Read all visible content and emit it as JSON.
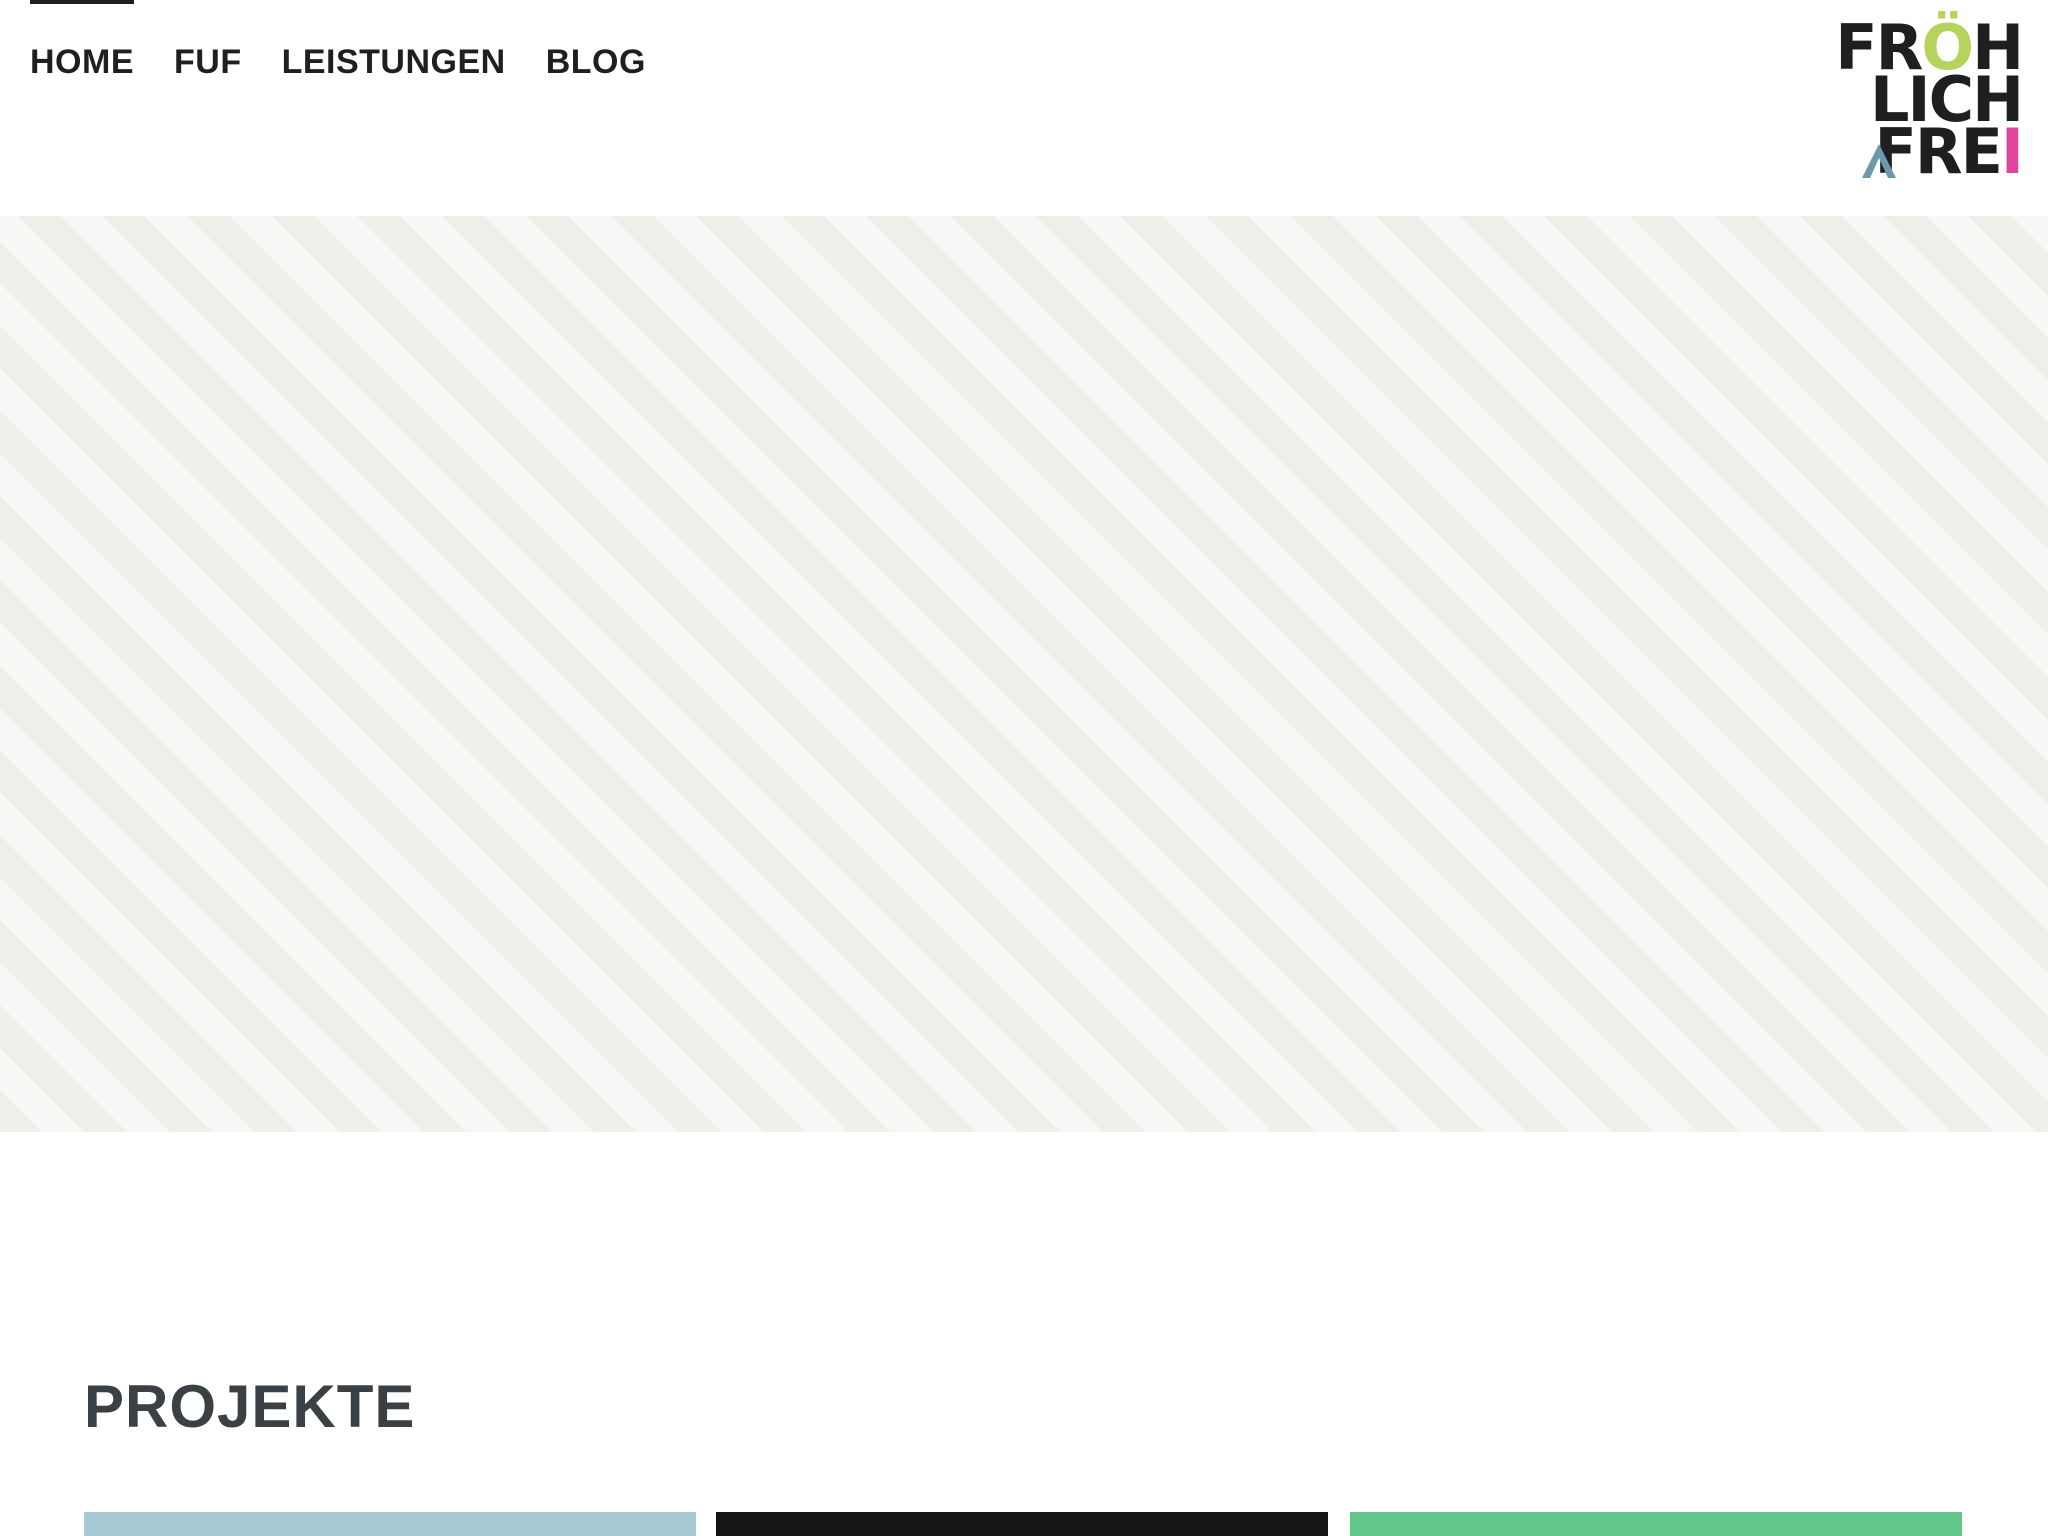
{
  "nav": {
    "items": [
      {
        "label": "HOME",
        "active": true
      },
      {
        "label": "FUF",
        "active": false
      },
      {
        "label": "LEISTUNGEN",
        "active": false
      },
      {
        "label": "BLOG",
        "active": false
      }
    ]
  },
  "logo": {
    "line1_a": "FR",
    "line1_o": "Ö",
    "line1_b": "H",
    "line2": "LICH",
    "line3_a": "FRE",
    "line3_i": "I",
    "colors": {
      "text": "#1d1f20",
      "o": "#b6d45c",
      "i": "#e0459e",
      "triangle": "#6b9aaa"
    }
  },
  "hero": {
    "stripe_colors": [
      "#efefea",
      "#f7f7f5"
    ]
  },
  "projects": {
    "title": "PROJEKTE",
    "cards": [
      {
        "color": "#a7c9d3"
      },
      {
        "color": "#151515"
      },
      {
        "color": "#62c58a"
      }
    ]
  }
}
